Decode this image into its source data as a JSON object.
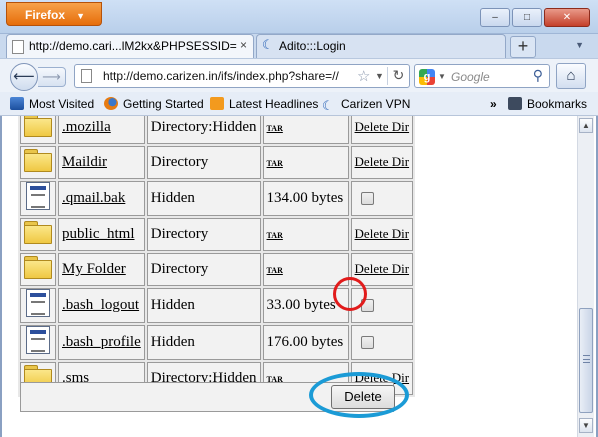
{
  "browser": {
    "app_button": "Firefox",
    "window_buttons": [
      "–",
      "□",
      "✕"
    ],
    "tabs": [
      {
        "label": "http://demo.cari...lM2kx&PHPSESSID=",
        "active": true,
        "close": "×"
      },
      {
        "label": "Adito:::Login",
        "active": false
      }
    ],
    "new_tab": "+",
    "url": "http://demo.carizen.in/ifs/index.php?share=//",
    "search_placeholder": "Google",
    "bookmarks": [
      "Most Visited",
      "Getting Started",
      "Latest Headlines",
      "Carizen VPN"
    ],
    "bookmarks_more": "»",
    "bookmarks_menu": "Bookmarks"
  },
  "files": {
    "rows": [
      {
        "icon": "folder-icon",
        "name": ".mozilla",
        "type": "Directory:Hidden",
        "size_link": "TAR",
        "action": "Delete Dir"
      },
      {
        "icon": "folder-icon",
        "name": "Maildir",
        "type": "Directory",
        "size_link": "TAR",
        "action": "Delete Dir"
      },
      {
        "icon": "file-icon",
        "name": ".qmail.bak",
        "type": "Hidden",
        "size": "134.00 bytes",
        "checkbox": true
      },
      {
        "icon": "folder-icon",
        "name": "public_html",
        "type": "Directory",
        "size_link": "TAR",
        "action": "Delete Dir"
      },
      {
        "icon": "folder-icon",
        "name": "My Folder",
        "type": "Directory",
        "size_link": "TAR",
        "action": "Delete Dir"
      },
      {
        "icon": "file-icon",
        "name": ".bash_logout",
        "type": "Hidden",
        "size": "33.00 bytes",
        "checkbox": true
      },
      {
        "icon": "file-icon",
        "name": ".bash_profile",
        "type": "Hidden",
        "size": "176.00 bytes",
        "checkbox": true
      },
      {
        "icon": "folder-icon",
        "name": ".sms",
        "type": "Directory:Hidden",
        "size_link": "TAR",
        "action": "Delete Dir"
      }
    ],
    "delete_button": "Delete"
  },
  "annotations": {
    "red_ring_color": "#e11b1b",
    "blue_ring_color": "#1b9bd6"
  }
}
